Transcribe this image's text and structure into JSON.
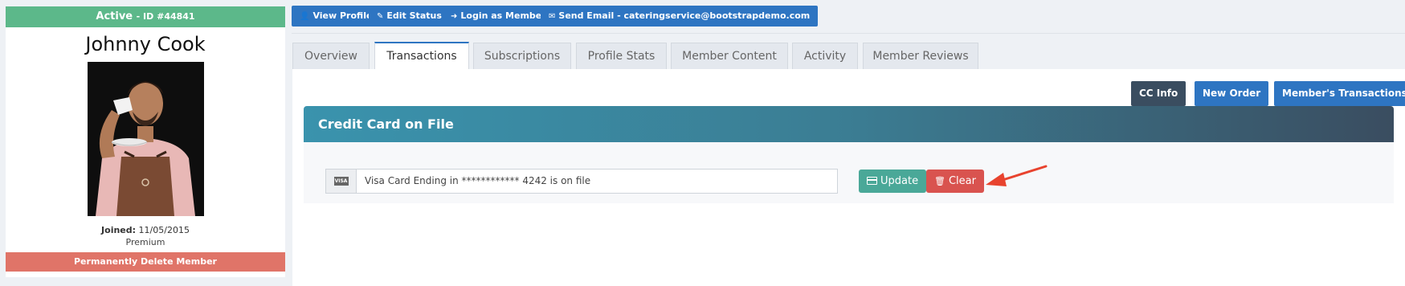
{
  "sidebar": {
    "status": "Active",
    "member_id": "- ID #44841",
    "name": "Johnny Cook",
    "joined_label": "Joined:",
    "joined_date": "11/05/2015",
    "membership": "Premium",
    "delete_label": "Permanently Delete Member"
  },
  "toolbar": {
    "view_profile": "View Profile",
    "edit_status": "Edit Status",
    "login_as_member": "Login as Member",
    "send_email": "Send Email - cateringservice@bootstrapdemo.com"
  },
  "tabs": [
    {
      "label": "Overview"
    },
    {
      "label": "Transactions",
      "active": true
    },
    {
      "label": "Subscriptions"
    },
    {
      "label": "Profile Stats"
    },
    {
      "label": "Member Content"
    },
    {
      "label": "Activity"
    },
    {
      "label": "Member Reviews"
    }
  ],
  "actions": {
    "cc_info": "CC Info",
    "new_order": "New Order",
    "member_transactions": "Member's Transactions"
  },
  "credit_card": {
    "title": "Credit Card on File",
    "card_type_badge": "VISA",
    "card_text": "Visa Card Ending in ************ 4242 is on file",
    "update_label": "Update",
    "clear_label": "Clear"
  },
  "colors": {
    "active_green": "#5cb88a",
    "primary_blue": "#2e75c2",
    "danger_red": "#d9534f",
    "update_teal": "#4aa898",
    "arrow_red": "#e8432e"
  }
}
